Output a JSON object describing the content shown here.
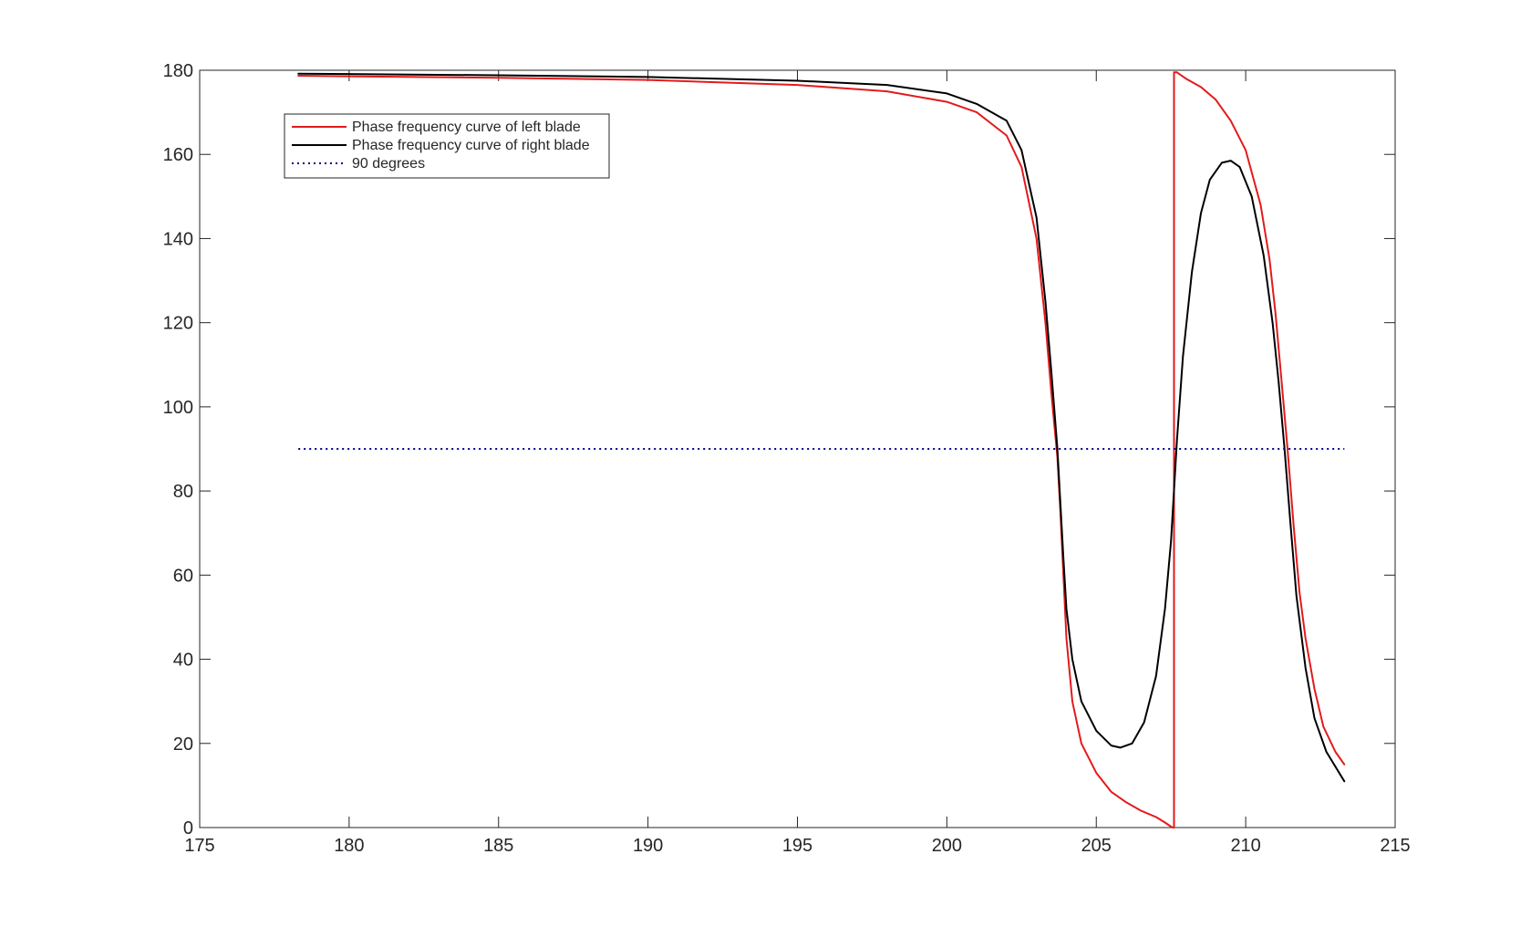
{
  "chart_data": {
    "type": "line",
    "title": "",
    "xlabel": "",
    "ylabel": "",
    "xlim": [
      175,
      215
    ],
    "ylim": [
      0,
      180
    ],
    "x_ticks": [
      175,
      180,
      185,
      190,
      195,
      200,
      205,
      210,
      215
    ],
    "y_ticks": [
      0,
      20,
      40,
      60,
      80,
      100,
      120,
      140,
      160,
      180
    ],
    "x_tick_labels": [
      "175",
      "180",
      "185",
      "190",
      "195",
      "200",
      "205",
      "210",
      "215"
    ],
    "y_tick_labels": [
      "0",
      "20",
      "40",
      "60",
      "80",
      "100",
      "120",
      "140",
      "160",
      "180"
    ],
    "grid": false,
    "box": true,
    "legend": {
      "placement": "top-left",
      "entries": [
        "Phase frequency curve of left blade",
        "Phase frequency curve of right blade",
        "90 degrees"
      ]
    },
    "series": [
      {
        "name": "Phase frequency curve of left blade",
        "color": "#e31a1c",
        "style": "solid",
        "x": [
          178.3,
          185,
          190,
          195,
          198,
          200,
          201,
          202,
          202.5,
          203,
          203.3,
          203.5,
          203.7,
          203.8,
          203.9,
          204.0,
          204.2,
          204.5,
          205,
          205.5,
          206,
          206.5,
          207,
          207.3,
          207.55,
          207.6,
          207.6,
          207.7,
          208,
          208.5,
          209,
          209.5,
          210,
          210.5,
          210.8,
          211.0,
          211.2,
          211.4,
          211.6,
          211.8,
          212,
          212.3,
          212.6,
          213,
          213.3
        ],
        "y": [
          178.7,
          178.2,
          177.7,
          176.5,
          175.0,
          172.5,
          170.0,
          164.5,
          157.0,
          140.0,
          120.0,
          103.0,
          88.0,
          75.0,
          60.0,
          45.0,
          30.0,
          20.0,
          13.0,
          8.5,
          6.0,
          4.0,
          2.5,
          1.2,
          0.0,
          0.0,
          179.5,
          179.5,
          178.0,
          176.0,
          173.0,
          168.0,
          161.0,
          148.0,
          135.0,
          122.0,
          106.0,
          90.0,
          72.0,
          56.0,
          45.0,
          33.0,
          24.0,
          18.0,
          15.0
        ]
      },
      {
        "name": "Phase frequency curve of right blade",
        "color": "#000000",
        "style": "solid",
        "x": [
          178.3,
          185,
          190,
          195,
          198,
          200,
          201,
          202,
          202.5,
          203,
          203.3,
          203.5,
          203.7,
          203.8,
          203.9,
          204.0,
          204.2,
          204.5,
          205,
          205.5,
          205.8,
          206.2,
          206.6,
          207.0,
          207.3,
          207.5,
          207.7,
          207.9,
          208.2,
          208.5,
          208.8,
          209.2,
          209.5,
          209.8,
          210.2,
          210.6,
          210.9,
          211.1,
          211.3,
          211.5,
          211.7,
          212,
          212.3,
          212.7,
          213.3
        ],
        "y": [
          179.2,
          178.8,
          178.4,
          177.5,
          176.5,
          174.5,
          172.0,
          168.0,
          161.0,
          145.0,
          125.0,
          108.0,
          90.0,
          77.0,
          64.0,
          52.0,
          40.0,
          30.0,
          23.0,
          19.5,
          19.0,
          20.0,
          25.0,
          36.0,
          52.0,
          68.0,
          92.0,
          112.0,
          132.0,
          146.0,
          154.0,
          158.0,
          158.5,
          157.0,
          150.0,
          136.0,
          120.0,
          106.0,
          90.0,
          72.0,
          55.0,
          38.0,
          26.0,
          18.0,
          11.0
        ]
      },
      {
        "name": "90 degrees",
        "color": "#00008b",
        "style": "dotted",
        "x": [
          178.3,
          213.3
        ],
        "y": [
          90,
          90
        ]
      }
    ]
  }
}
